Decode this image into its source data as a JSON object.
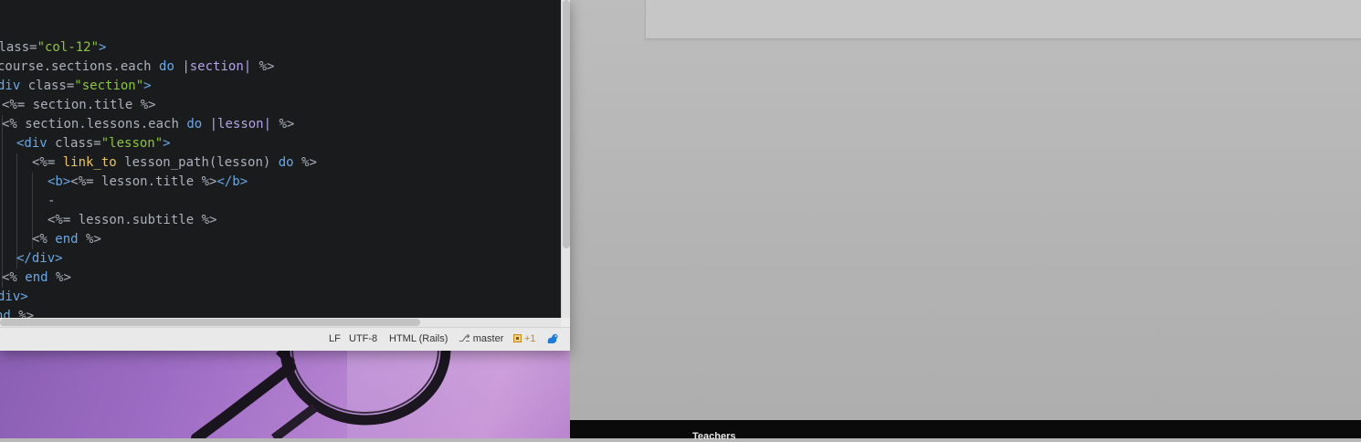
{
  "editor": {
    "code_lines": [
      {
        "segments": [
          {
            "t": "class=",
            "c": "d"
          },
          {
            "t": "\"col-12\"",
            "c": "s"
          },
          {
            "t": ">",
            "c": "k"
          }
        ]
      },
      {
        "segments": [
          {
            "t": "course.sections.each ",
            "c": "d"
          },
          {
            "t": "do ",
            "c": "k"
          },
          {
            "t": "|section| ",
            "c": "v"
          },
          {
            "t": "%>",
            "c": "d"
          }
        ]
      },
      {
        "segments": [
          {
            "t": "div ",
            "c": "k"
          },
          {
            "t": "class=",
            "c": "d"
          },
          {
            "t": "\"section\"",
            "c": "s"
          },
          {
            "t": ">",
            "c": "k"
          }
        ]
      },
      {
        "segments": [
          {
            "t": "<%= ",
            "c": "d"
          },
          {
            "t": "section.title ",
            "c": "d"
          },
          {
            "t": "%>",
            "c": "d"
          }
        ]
      },
      {
        "segments": [
          {
            "t": "<% ",
            "c": "d"
          },
          {
            "t": "section.lessons.each ",
            "c": "d"
          },
          {
            "t": "do ",
            "c": "k"
          },
          {
            "t": "|lesson| ",
            "c": "v"
          },
          {
            "t": "%>",
            "c": "d"
          }
        ]
      },
      {
        "segments": [
          {
            "t": "<div ",
            "c": "k"
          },
          {
            "t": "class=",
            "c": "d"
          },
          {
            "t": "\"lesson\"",
            "c": "s"
          },
          {
            "t": ">",
            "c": "k"
          }
        ]
      },
      {
        "segments": [
          {
            "t": "<%= ",
            "c": "d"
          },
          {
            "t": "link_to ",
            "c": "t"
          },
          {
            "t": "lesson_path(lesson) ",
            "c": "d"
          },
          {
            "t": "do ",
            "c": "k"
          },
          {
            "t": "%>",
            "c": "d"
          }
        ]
      },
      {
        "segments": [
          {
            "t": "<b>",
            "c": "k"
          },
          {
            "t": "<%= ",
            "c": "d"
          },
          {
            "t": "lesson.title ",
            "c": "d"
          },
          {
            "t": "%>",
            "c": "d"
          },
          {
            "t": "</b>",
            "c": "k"
          }
        ]
      },
      {
        "segments": [
          {
            "t": "-",
            "c": "d"
          }
        ]
      },
      {
        "segments": [
          {
            "t": "<%= ",
            "c": "d"
          },
          {
            "t": "lesson.subtitle ",
            "c": "d"
          },
          {
            "t": "%>",
            "c": "d"
          }
        ]
      },
      {
        "segments": [
          {
            "t": "<% ",
            "c": "d"
          },
          {
            "t": "end ",
            "c": "k"
          },
          {
            "t": "%>",
            "c": "d"
          }
        ]
      },
      {
        "segments": [
          {
            "t": "</div>",
            "c": "k"
          }
        ]
      },
      {
        "segments": [
          {
            "t": "<% ",
            "c": "d"
          },
          {
            "t": "end ",
            "c": "k"
          },
          {
            "t": "%>",
            "c": "d"
          }
        ]
      },
      {
        "segments": [
          {
            "t": "div>",
            "c": "k"
          }
        ]
      },
      {
        "segments": [
          {
            "t": "nd ",
            "c": "k"
          },
          {
            "t": "%>",
            "c": "d"
          }
        ]
      }
    ]
  },
  "status_bar": {
    "line_ending": "LF",
    "encoding": "UTF-8",
    "grammar": "HTML (Rails)",
    "branch_icon": "git-branch-icon",
    "branch": "master",
    "git_changes": "+1",
    "github_icon": "squirrel-icon"
  },
  "page_footer": {
    "link": "Teachers"
  },
  "colors": {
    "editor_bg": "#191b1c",
    "keyword": "#6aa8e6",
    "string": "#8ec53f",
    "function": "#e8c465",
    "param": "#b4a3e8",
    "github_blue": "#1f7bd6"
  }
}
